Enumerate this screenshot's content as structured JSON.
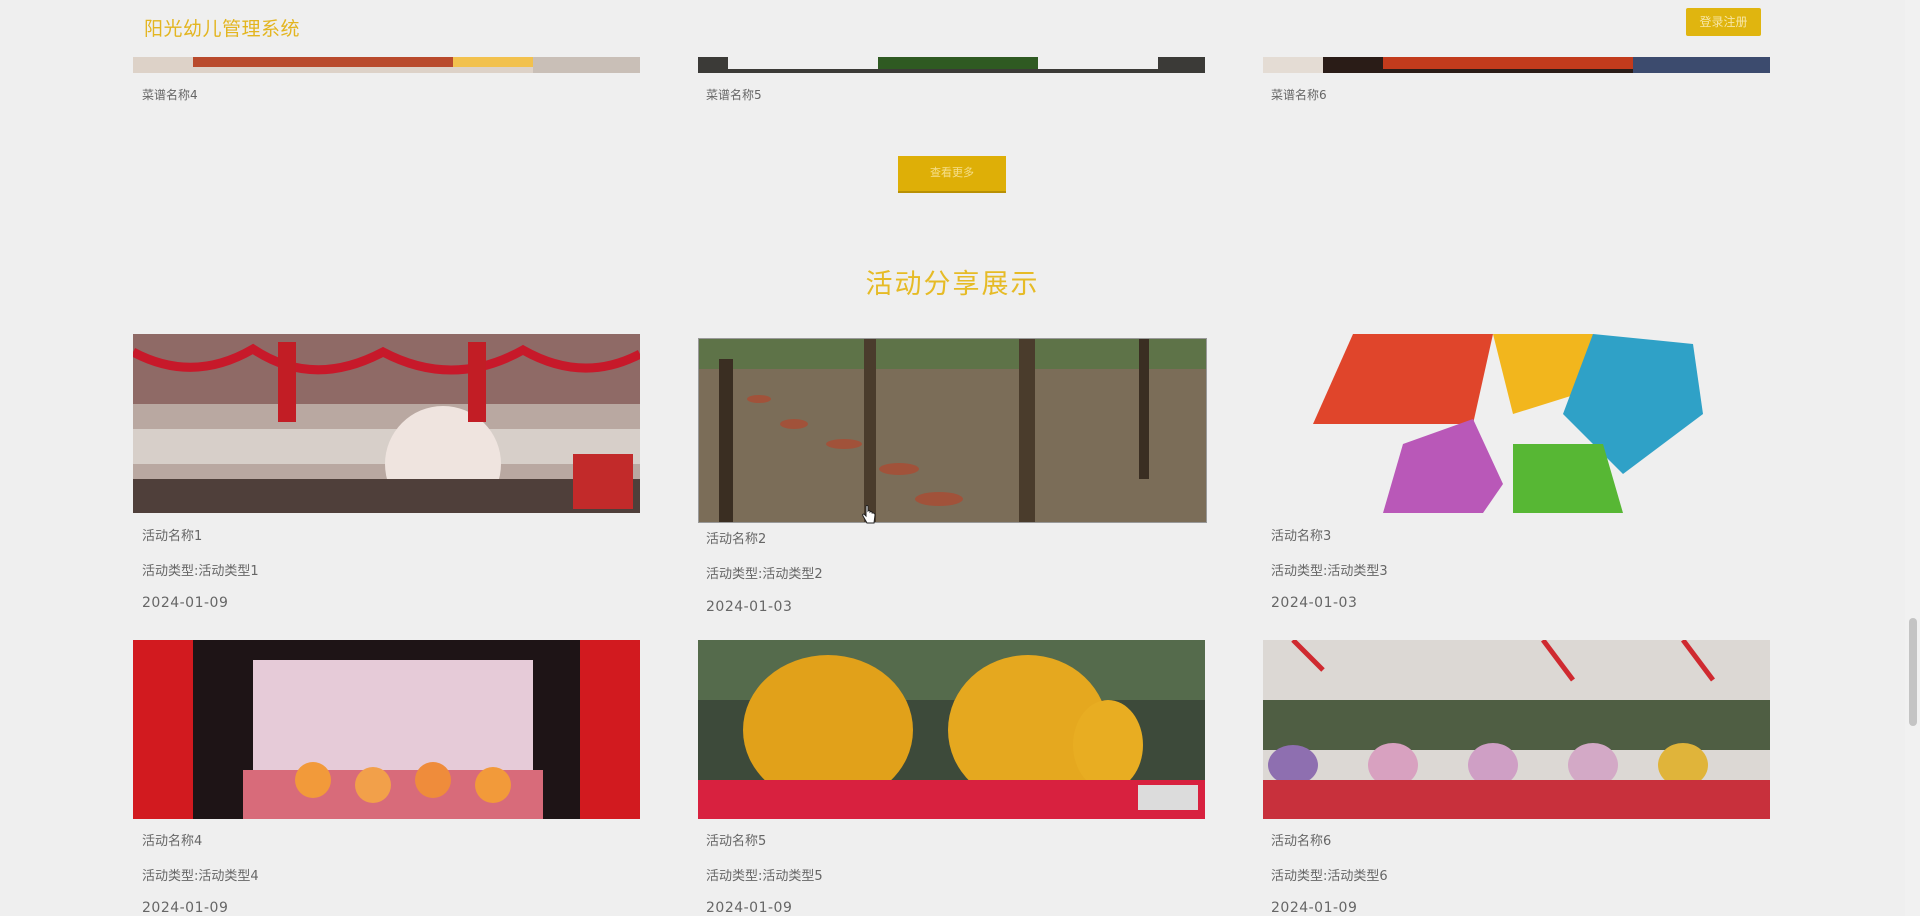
{
  "header": {
    "title": "阳光幼儿管理系统",
    "login_label": "登录注册"
  },
  "recipes": [
    {
      "name": "菜谱名称4"
    },
    {
      "name": "菜谱名称5"
    },
    {
      "name": "菜谱名称6"
    }
  ],
  "more_button": {
    "label": "查看更多"
  },
  "activity_section": {
    "title": "活动分享展示",
    "items": [
      {
        "name": "活动名称1",
        "type": "活动类型:活动类型1",
        "date": "2024-01-09"
      },
      {
        "name": "活动名称2",
        "type": "活动类型:活动类型2",
        "date": "2024-01-03"
      },
      {
        "name": "活动名称3",
        "type": "活动类型:活动类型3",
        "date": "2024-01-03"
      },
      {
        "name": "活动名称4",
        "type": "活动类型:活动类型4",
        "date": "2024-01-09"
      },
      {
        "name": "活动名称5",
        "type": "活动类型:活动类型5",
        "date": "2024-01-09"
      },
      {
        "name": "活动名称6",
        "type": "活动类型:活动类型6",
        "date": "2024-01-09"
      }
    ]
  },
  "colors": {
    "accent": "#e0b50f",
    "background": "#efefef"
  }
}
